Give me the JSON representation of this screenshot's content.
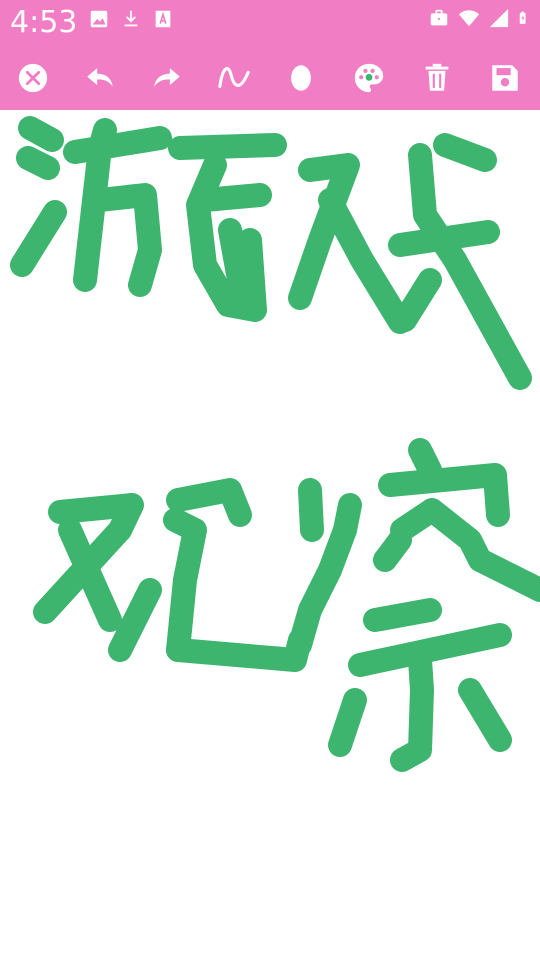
{
  "status_bar": {
    "time": "4:53",
    "left_icons": [
      "image-icon",
      "download-icon",
      "font-icon"
    ],
    "right_icons": [
      "briefcase-icon",
      "wifi-icon",
      "signal-icon",
      "battery-icon"
    ]
  },
  "toolbar": {
    "tools": [
      {
        "name": "close-button",
        "icon": "close-icon"
      },
      {
        "name": "undo-button",
        "icon": "undo-icon"
      },
      {
        "name": "redo-button",
        "icon": "redo-icon"
      },
      {
        "name": "brush-button",
        "icon": "wave-icon"
      },
      {
        "name": "eraser-button",
        "icon": "ellipse-icon"
      },
      {
        "name": "color-button",
        "icon": "palette-icon"
      },
      {
        "name": "clear-button",
        "icon": "trash-icon"
      },
      {
        "name": "save-button",
        "icon": "save-icon"
      }
    ]
  },
  "colors": {
    "app_bar": "#F17DC4",
    "icon": "#FFFFFF",
    "stroke": "#3DB56E",
    "canvas": "#FFFFFF"
  }
}
